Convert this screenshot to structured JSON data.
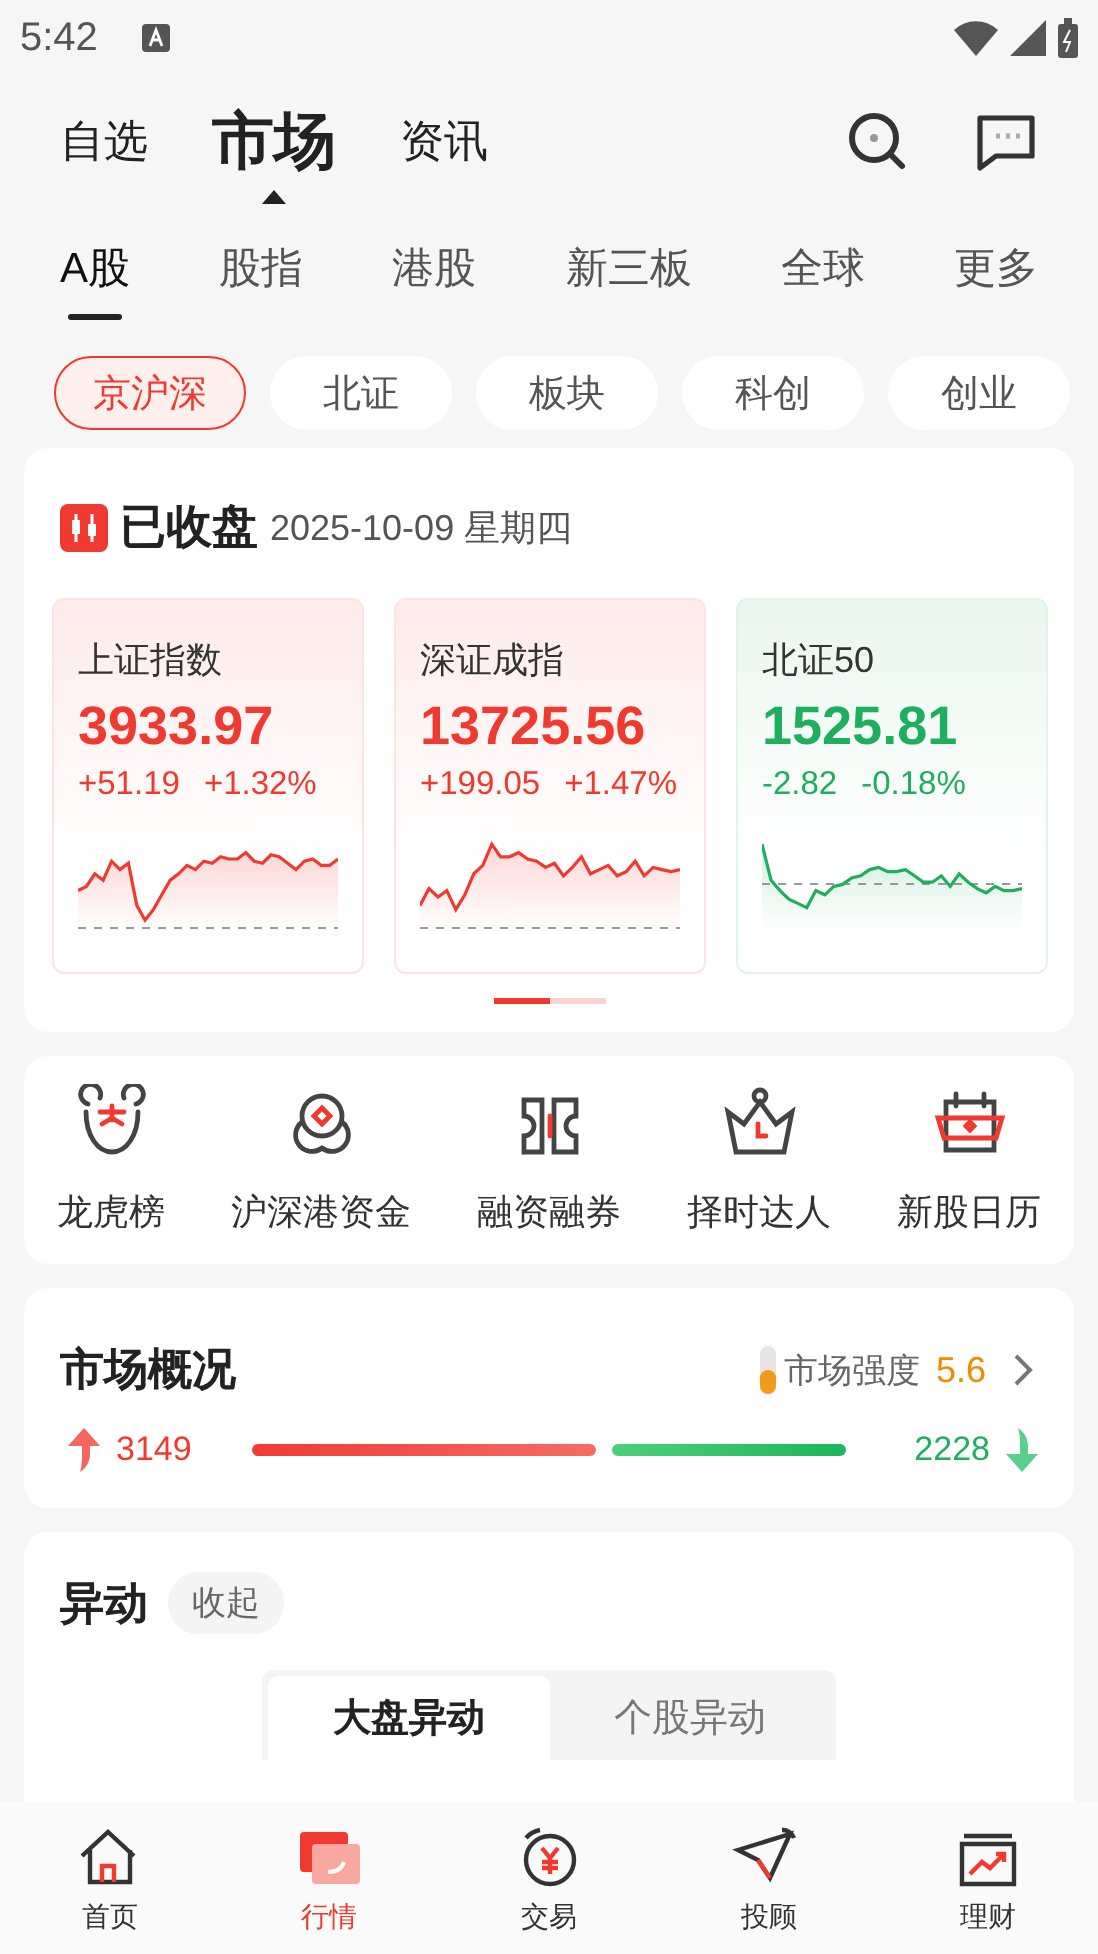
{
  "status_bar": {
    "time": "5:42"
  },
  "header_tabs": [
    {
      "label": "自选",
      "selected": false
    },
    {
      "label": "市场",
      "selected": true
    },
    {
      "label": "资讯",
      "selected": false
    }
  ],
  "market_tabs": [
    {
      "label": "A股",
      "selected": true
    },
    {
      "label": "股指",
      "selected": false
    },
    {
      "label": "港股",
      "selected": false
    },
    {
      "label": "新三板",
      "selected": false
    },
    {
      "label": "全球",
      "selected": false
    },
    {
      "label": "更多",
      "selected": false
    }
  ],
  "chips": [
    {
      "label": "京沪深",
      "selected": true
    },
    {
      "label": "北证",
      "selected": false
    },
    {
      "label": "板块",
      "selected": false
    },
    {
      "label": "科创",
      "selected": false
    },
    {
      "label": "创业",
      "selected": false
    }
  ],
  "session": {
    "status": "已收盘",
    "date": "2025-10-09 星期四"
  },
  "indices": [
    {
      "name": "上证指数",
      "value": "3933.97",
      "change": "+51.19",
      "percent": "+1.32%",
      "color": "#f0392f"
    },
    {
      "name": "深证成指",
      "value": "13725.56",
      "change": "+199.05",
      "percent": "+1.47%",
      "color": "#f0392f"
    },
    {
      "name": "北证50",
      "value": "1525.81",
      "change": "-2.82",
      "percent": "-0.18%",
      "color": "#1fae5e"
    }
  ],
  "pager": [
    {
      "selected": true
    },
    {
      "selected": false
    }
  ],
  "shortcuts": [
    {
      "label": "龙虎榜"
    },
    {
      "label": "沪深港资金"
    },
    {
      "label": "融资融券"
    },
    {
      "label": "择时达人"
    },
    {
      "label": "新股日历"
    }
  ],
  "overview": {
    "title": "市场概况",
    "strength_label": "市场强度",
    "strength_value": "5.6",
    "rising": "3149",
    "falling": "2228"
  },
  "movers": {
    "title": "异动",
    "collapse": "收起",
    "tabs": [
      {
        "label": "大盘异动",
        "selected": true
      },
      {
        "label": "个股异动",
        "selected": false
      }
    ]
  },
  "bottom_nav": [
    {
      "label": "首页",
      "selected": false
    },
    {
      "label": "行情",
      "selected": true
    },
    {
      "label": "交易",
      "selected": false
    },
    {
      "label": "投顾",
      "selected": false
    },
    {
      "label": "理财",
      "selected": false
    }
  ]
}
